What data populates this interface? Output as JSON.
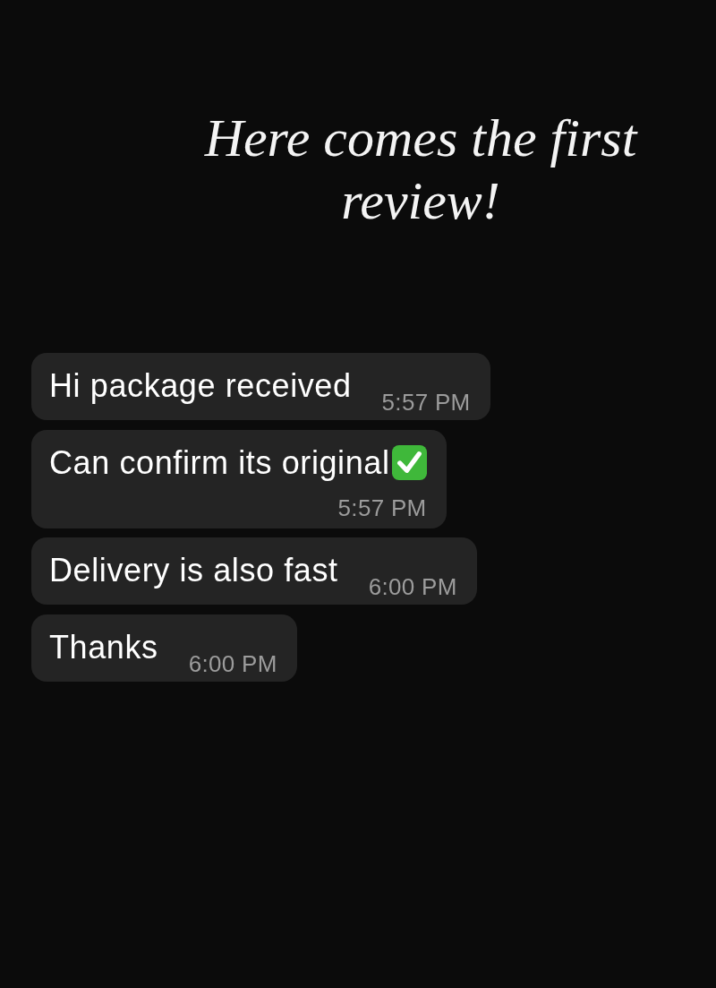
{
  "title": "Here comes the first review!",
  "messages": [
    {
      "kind": "inline",
      "text": "Hi package received",
      "check_mark": false,
      "time": "5:57 PM"
    },
    {
      "kind": "stacked",
      "text": "Can confirm its original",
      "check_mark": true,
      "time": "5:57 PM"
    },
    {
      "kind": "inline",
      "text": "Delivery is also fast",
      "check_mark": false,
      "time": "6:00 PM"
    },
    {
      "kind": "inline",
      "text": "Thanks",
      "check_mark": false,
      "time": "6:00 PM"
    }
  ]
}
